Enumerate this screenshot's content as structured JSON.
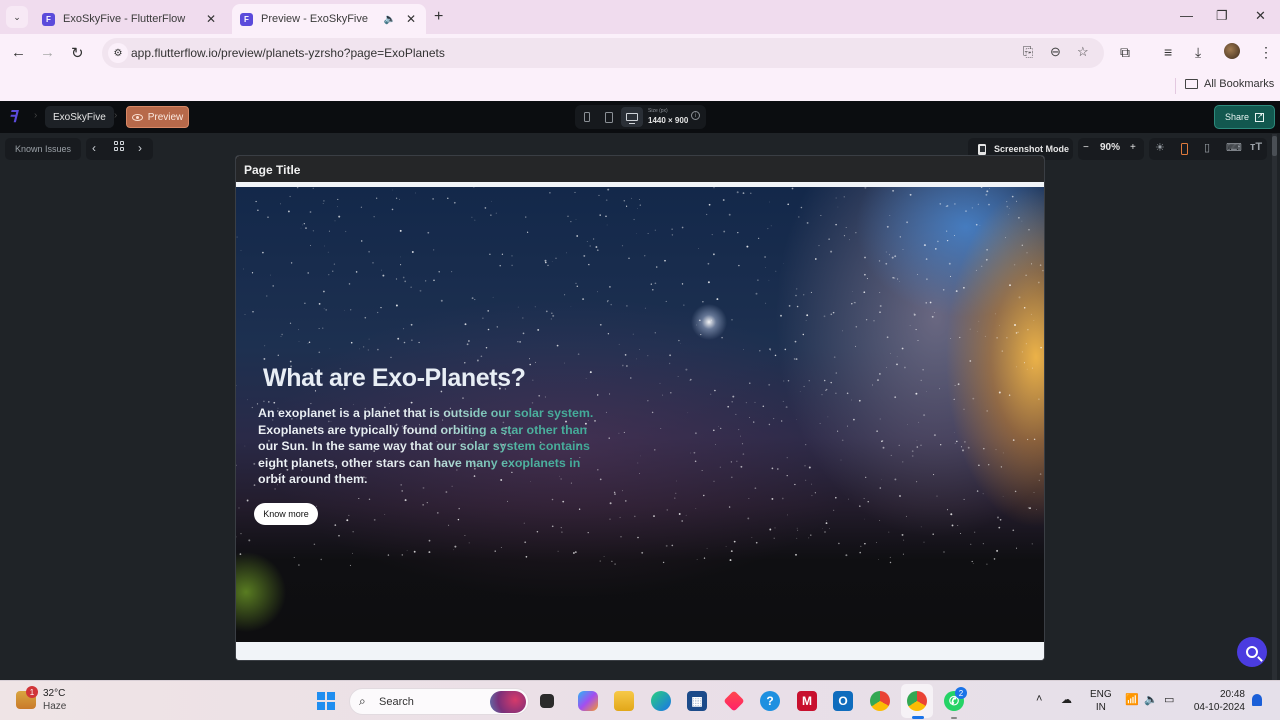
{
  "browser": {
    "tabs": [
      {
        "title": "ExoSkyFive - FlutterFlow",
        "active": false,
        "favicon": "flutterflow-icon"
      },
      {
        "title": "Preview - ExoSkyFive",
        "active": true,
        "favicon": "flutterflow-icon",
        "audio": true
      }
    ],
    "new_tab_symbol": "+",
    "window_controls": {
      "minimize": "—",
      "restore": "❐",
      "close": "✕"
    },
    "nav": {
      "back": "←",
      "forward": "→",
      "reload": "↻"
    },
    "address": {
      "url": "app.flutterflow.io/preview/planets-yzrsho?page=ExoPlanets"
    },
    "omnibox_icons": [
      "install-app-icon",
      "zoom-out-icon",
      "bookmark-star-icon"
    ],
    "toolbar_icons": [
      "extensions-icon",
      "media-control-icon",
      "download-icon",
      "profile-avatar",
      "menu-icon"
    ],
    "bookmarks_bar": {
      "all_bookmarks": "All Bookmarks"
    }
  },
  "flutterflow": {
    "project_name": "ExoSkyFive",
    "preview_label": "Preview",
    "device_size_label": "Size (px)",
    "device_size_value": "1440 × 900",
    "selected_device": "desktop",
    "share_label": "Share",
    "known_issues_label": "Known Issues",
    "screenshot_mode_label": "Screenshot Mode",
    "zoom_level": "90%",
    "zoom_minus": "−",
    "zoom_plus": "+",
    "accent_color": "#b7694a",
    "share_color": "#12584f"
  },
  "app_preview": {
    "page_title": "Page Title",
    "hero": {
      "heading": "What are Exo-Planets?",
      "body": "An exoplanet is a planet that is outside our solar system. Exoplanets are typically found orbiting a star other than our Sun. In the same way that our solar system contains eight planets, other stars can have many exoplanets in orbit around them.",
      "button_label": "Know more",
      "text_gradient": [
        "#eef2f6",
        "#3fa896"
      ]
    }
  },
  "taskbar": {
    "weather": {
      "temp": "32°C",
      "condition": "Haze",
      "badge": "1"
    },
    "search_placeholder": "Search",
    "apps": [
      {
        "name": "task-view"
      },
      {
        "name": "copilot"
      },
      {
        "name": "file-explorer"
      },
      {
        "name": "edge"
      },
      {
        "name": "microsoft-store"
      },
      {
        "name": "app-diamond"
      },
      {
        "name": "help"
      },
      {
        "name": "mcafee"
      },
      {
        "name": "outlook"
      },
      {
        "name": "chrome"
      },
      {
        "name": "chrome-profile",
        "active": true
      },
      {
        "name": "whatsapp",
        "badge": "2"
      }
    ],
    "tray": {
      "lang_top": "ENG",
      "lang_bottom": "IN",
      "time": "20:48",
      "date": "04-10-2024"
    }
  }
}
